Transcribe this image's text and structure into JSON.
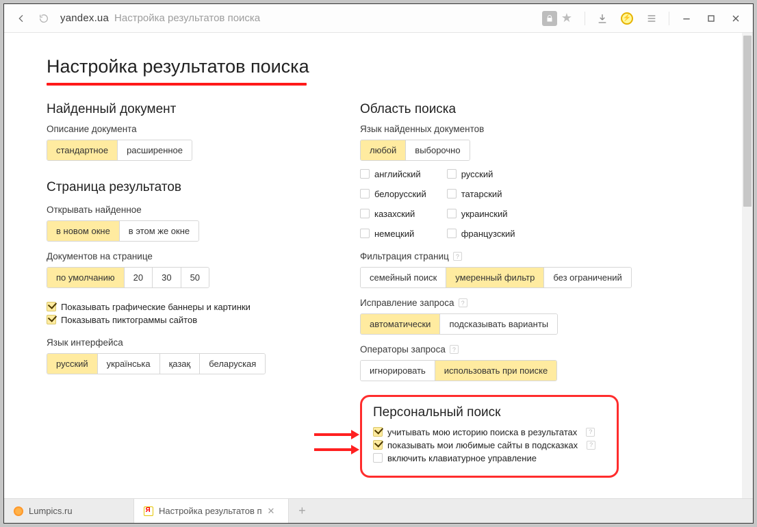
{
  "browser": {
    "domain": "yandex.ua",
    "title": "Настройка результатов поиска"
  },
  "page": {
    "heading": "Настройка результатов поиска"
  },
  "left": {
    "found_doc_h": "Найденный документ",
    "desc_label": "Описание документа",
    "desc_opts": {
      "std": "стандартное",
      "ext": "расширенное"
    },
    "results_page_h": "Страница результатов",
    "open_label": "Открывать найденное",
    "open_opts": {
      "newwin": "в новом окне",
      "same": "в этом же окне"
    },
    "perpage_label": "Документов на странице",
    "perpage_opts": {
      "def": "по умолчанию",
      "n20": "20",
      "n30": "30",
      "n50": "50"
    },
    "chk_banners": "Показывать графические баннеры и картинки",
    "chk_favicons": "Показывать пиктограммы сайтов",
    "ui_lang_label": "Язык интерфейса",
    "ui_lang_opts": {
      "ru": "русский",
      "uk": "українська",
      "kk": "қазақ",
      "be": "беларуская"
    }
  },
  "right": {
    "scope_h": "Область поиска",
    "doclang_label": "Язык найденных документов",
    "doclang_opts": {
      "any": "любой",
      "sel": "выборочно"
    },
    "langs_left": {
      "en": "английский",
      "be": "белорусский",
      "kk": "казахский",
      "de": "немецкий"
    },
    "langs_right": {
      "ru": "русский",
      "tt": "татарский",
      "uk": "украинский",
      "fr": "французский"
    },
    "filter_label": "Фильтрация страниц",
    "filter_opts": {
      "family": "семейный поиск",
      "moderate": "умеренный фильтр",
      "none": "без ограничений"
    },
    "correct_label": "Исправление запроса",
    "correct_opts": {
      "auto": "автоматически",
      "suggest": "подсказывать варианты"
    },
    "ops_label": "Операторы запроса",
    "ops_opts": {
      "ignore": "игнорировать",
      "use": "использовать при поиске"
    },
    "personal_h": "Персональный поиск",
    "personal_history": "учитывать мою историю поиска в результатах",
    "personal_fav": "показывать мои любимые сайты в подсказках",
    "personal_kb": "включить клавиатурное управление"
  },
  "tabs": {
    "t1": "Lumpics.ru",
    "t2": "Настройка результатов п"
  }
}
